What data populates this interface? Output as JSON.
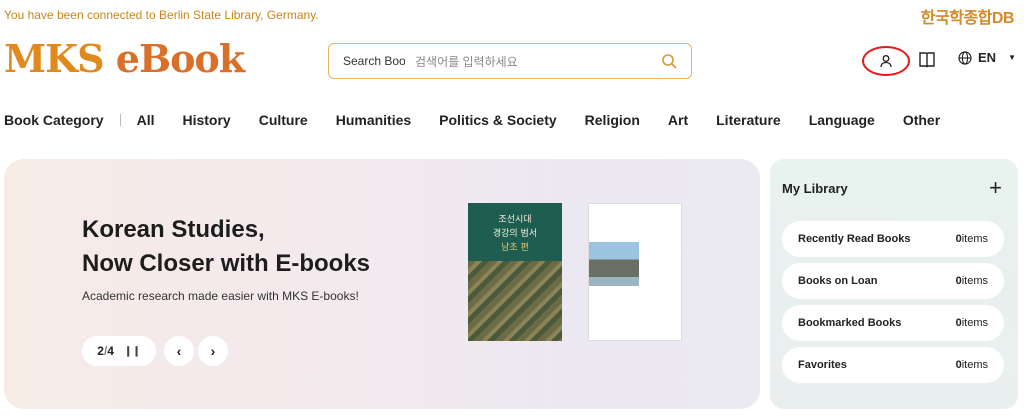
{
  "connection_notice": "You have been connected to Berlin State Library, Germany.",
  "partner_logo": "한국학종합DB",
  "logo": {
    "part1": "MKS",
    "part2": "eBook"
  },
  "search": {
    "select_value": "Search Book",
    "placeholder": "검색어를 입력하세요"
  },
  "header": {
    "language": "EN"
  },
  "nav": {
    "label": "Book Category",
    "items": [
      "All",
      "History",
      "Culture",
      "Humanities",
      "Politics & Society",
      "Religion",
      "Art",
      "Literature",
      "Language",
      "Other"
    ]
  },
  "hero": {
    "title_line1": "Korean Studies,",
    "title_line2": "Now Closer with E-books",
    "subtitle": "Academic research made easier with MKS E-books!",
    "pager": {
      "current": "2",
      "sep": "/",
      "total": "4"
    },
    "book1_title_line1": "조선시대",
    "book1_title_line2": "경강의 범서",
    "book1_title_line3": "남초 편"
  },
  "library": {
    "title": "My Library",
    "rows": [
      {
        "label": "Recently Read Books",
        "count": "0",
        "unit": "items"
      },
      {
        "label": "Books on Loan",
        "count": "0",
        "unit": "items"
      },
      {
        "label": "Bookmarked Books",
        "count": "0",
        "unit": "items"
      },
      {
        "label": "Favorites",
        "count": "0",
        "unit": "items"
      }
    ]
  }
}
